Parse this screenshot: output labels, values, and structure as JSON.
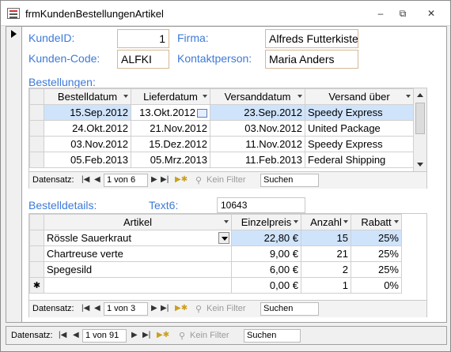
{
  "window": {
    "title": "frmKundenBestellungenArtikel"
  },
  "form": {
    "kundeid_label": "KundeID:",
    "kundeid_value": "1",
    "firma_label": "Firma:",
    "firma_value": "Alfreds Futterkiste",
    "kundencode_label": "Kunden-Code:",
    "kundencode_value": "ALFKI",
    "kontakt_label": "Kontaktperson:",
    "kontakt_value": "Maria Anders",
    "bestellungen_label": "Bestellungen:",
    "bestelldetails_label": "Bestelldetails:",
    "text6_label": "Text6:",
    "text6_value": "10643"
  },
  "orders": {
    "headers": [
      "Bestelldatum",
      "Lieferdatum",
      "Versanddatum",
      "Versand über"
    ],
    "rows": [
      [
        "15.Sep.2012",
        "13.Okt.2012",
        "23.Sep.2012",
        "Speedy Express"
      ],
      [
        "24.Okt.2012",
        "21.Nov.2012",
        "03.Nov.2012",
        "United Package"
      ],
      [
        "03.Nov.2012",
        "15.Dez.2012",
        "11.Nov.2012",
        "Speedy Express"
      ],
      [
        "05.Feb.2013",
        "05.Mrz.2013",
        "11.Feb.2013",
        "Federal Shipping"
      ]
    ],
    "nav": {
      "label": "Datensatz:",
      "record": "1 von 6",
      "filter": "Kein Filter",
      "search": "Suchen"
    }
  },
  "details": {
    "headers": [
      "Artikel",
      "Einzelpreis",
      "Anzahl",
      "Rabatt"
    ],
    "rows": [
      [
        "Rössle Sauerkraut",
        "22,80 €",
        "15",
        "25%"
      ],
      [
        "Chartreuse verte",
        "9,00 €",
        "21",
        "25%"
      ],
      [
        "Spegesild",
        "6,00 €",
        "2",
        "25%"
      ],
      [
        "",
        "0,00 €",
        "1",
        "0%"
      ]
    ],
    "new_row_marker": "✱",
    "nav": {
      "label": "Datensatz:",
      "record": "1 von 3",
      "filter": "Kein Filter",
      "search": "Suchen"
    }
  },
  "main_nav": {
    "label": "Datensatz:",
    "record": "1 von 91",
    "filter": "Kein Filter",
    "search": "Suchen"
  },
  "colors": {
    "label_blue": "#3d7ad8",
    "selection": "#cfe3fb"
  }
}
